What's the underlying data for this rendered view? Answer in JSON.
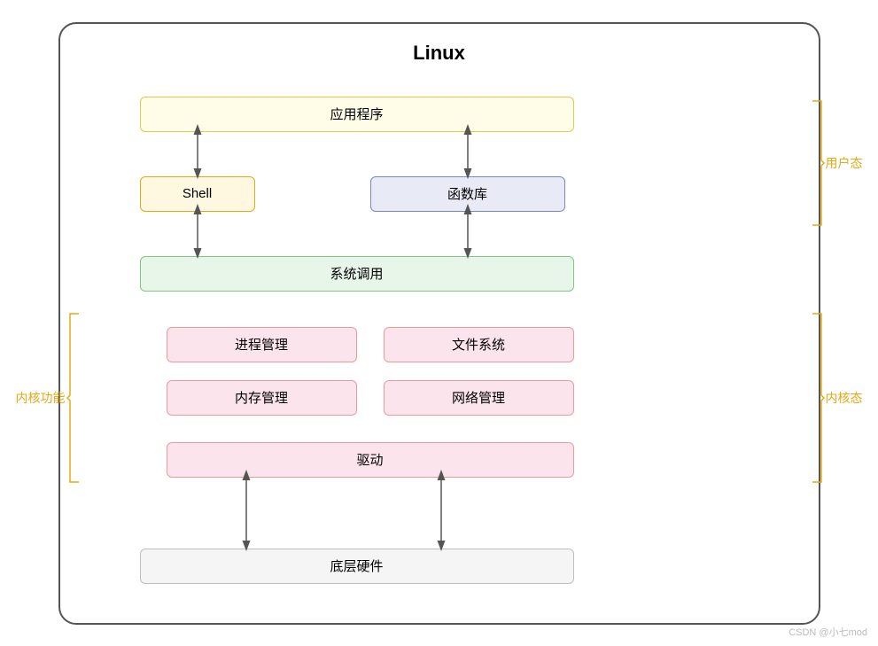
{
  "title": "Linux",
  "boxes": {
    "app": "应用程序",
    "shell": "Shell",
    "lib": "函数库",
    "syscall": "系统调用",
    "proc": "进程管理",
    "fs": "文件系统",
    "mem": "内存管理",
    "net": "网络管理",
    "driver": "驱动",
    "hw": "底层硬件"
  },
  "labels": {
    "user": "用户态",
    "kernel": "内核态",
    "kernel_func": "内核功能"
  },
  "watermark": "CSDN @小七mod"
}
